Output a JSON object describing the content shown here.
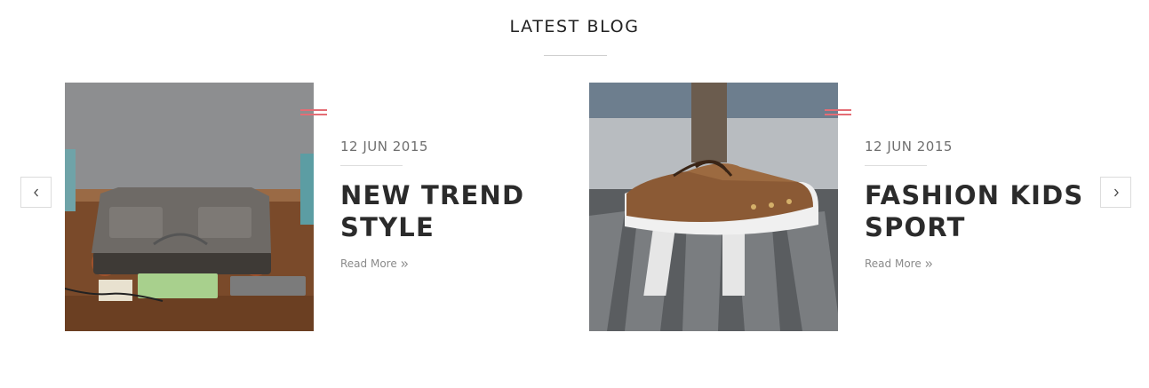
{
  "section": {
    "title": "LATEST BLOG"
  },
  "nav": {
    "prev_icon": "chevron-left-icon",
    "next_icon": "chevron-right-icon"
  },
  "posts": [
    {
      "date": "12 JUN 2015",
      "title": "NEW TREND STYLE",
      "read_more": "Read More",
      "read_more_icon": "double-chevron-right-icon"
    },
    {
      "date": "12 JUN 2015",
      "title": "FASHION KIDS SPORT",
      "read_more": "Read More",
      "read_more_icon": "double-chevron-right-icon"
    }
  ],
  "colors": {
    "accent": "#e36d75",
    "text": "#2b2b2b",
    "muted": "#8a8a8a"
  }
}
